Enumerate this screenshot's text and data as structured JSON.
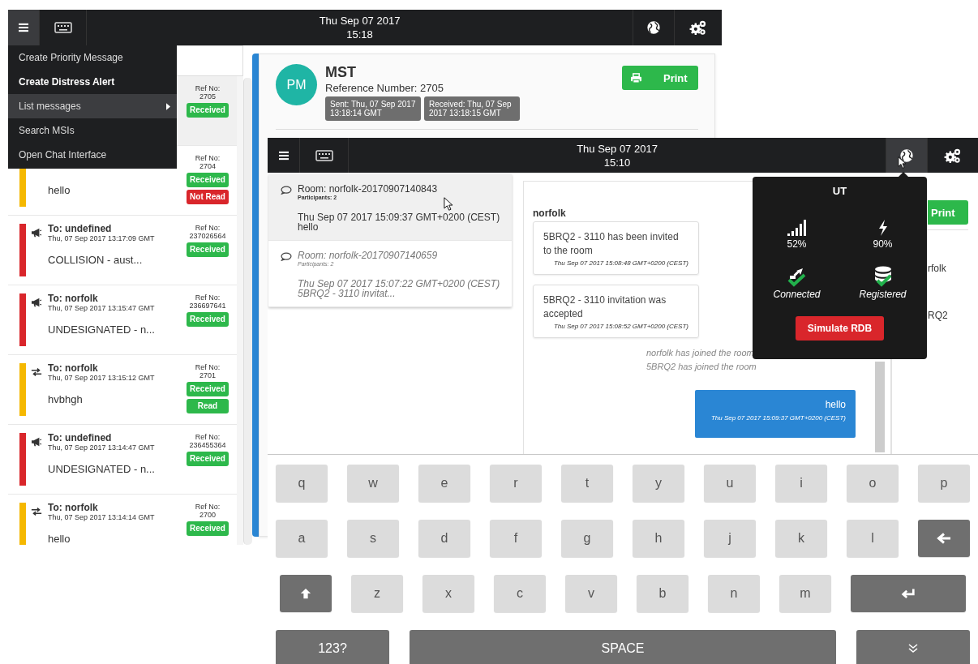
{
  "back_window": {
    "header": {
      "menu_selected": true,
      "date": "Thu Sep 07 2017",
      "time": "15:18"
    },
    "menu": [
      {
        "label": "Create Priority Message",
        "bold": false,
        "selected": false,
        "submenu": false
      },
      {
        "label": "Create Distress Alert",
        "bold": true,
        "selected": false,
        "submenu": false
      },
      {
        "label": "List messages",
        "bold": false,
        "selected": true,
        "submenu": true
      },
      {
        "label": "Search MSIs",
        "bold": false,
        "selected": false,
        "submenu": false
      },
      {
        "label": "Open Chat Interface",
        "bold": false,
        "selected": false,
        "submenu": false
      }
    ],
    "messages": [
      {
        "selected": true,
        "ref_label": "Ref No:",
        "ref": "2705",
        "badges": [
          {
            "label": "Received",
            "kind": "ok"
          }
        ]
      },
      {
        "selected": false,
        "color": "#f5b800",
        "body": "hello",
        "ref_label": "Ref No:",
        "ref": "2704",
        "badges": [
          {
            "label": "Received",
            "kind": "ok"
          },
          {
            "label": "Not Read",
            "kind": "alert"
          }
        ]
      },
      {
        "selected": false,
        "color": "#d9262b",
        "kind": "broadcast",
        "to": "To: undefined",
        "date": "Thu, 07 Sep 2017 13:17:09 GMT",
        "body": "COLLISION - aust...",
        "ref_label": "Ref No:",
        "ref": "237026564",
        "badges": [
          {
            "label": "Received",
            "kind": "ok"
          }
        ]
      },
      {
        "selected": false,
        "color": "#d9262b",
        "kind": "broadcast",
        "to": "To: norfolk",
        "date": "Thu, 07 Sep 2017 13:15:47 GMT",
        "body": "UNDESIGNATED - n...",
        "ref_label": "Ref No:",
        "ref": "236697641",
        "badges": [
          {
            "label": "Received",
            "kind": "ok"
          }
        ]
      },
      {
        "selected": false,
        "color": "#f5b800",
        "kind": "exchange",
        "to": "To: norfolk",
        "date": "Thu, 07 Sep 2017 13:15:12 GMT",
        "body": "hvbhgh",
        "ref_label": "Ref No:",
        "ref": "2701",
        "badges": [
          {
            "label": "Received",
            "kind": "ok"
          },
          {
            "label": "Read",
            "kind": "ok"
          }
        ]
      },
      {
        "selected": false,
        "color": "#d9262b",
        "kind": "broadcast",
        "to": "To: undefined",
        "date": "Thu, 07 Sep 2017 13:14:47 GMT",
        "body": "UNDESIGNATED - n...",
        "ref_label": "Ref No:",
        "ref": "236455364",
        "badges": [
          {
            "label": "Received",
            "kind": "ok"
          }
        ]
      },
      {
        "selected": false,
        "color": "#f5b800",
        "kind": "exchange",
        "to": "To: norfolk",
        "date": "Thu, 07 Sep 2017 13:14:14 GMT",
        "body": "hello",
        "ref_label": "Ref No:",
        "ref": "2700",
        "badges": [
          {
            "label": "Received",
            "kind": "ok"
          }
        ]
      }
    ],
    "detail": {
      "avatar": "PM",
      "title": "MST",
      "reference": "Reference Number: 2705",
      "chips": [
        "Sent: Thu, 07 Sep 2017 13:18:14 GMT",
        "Received: Thu, 07 Sep 2017 13:18:15 GMT"
      ],
      "print": "Print"
    }
  },
  "front_window": {
    "header": {
      "globe_selected": true,
      "date": "Thu Sep 07 2017",
      "time": "15:10"
    },
    "rooms": [
      {
        "selected": true,
        "name": "Room: norfolk-20170907140843",
        "participants": "Participants: 2",
        "date": "Thu Sep 07 2017 15:09:37 GMT+0200 (CEST)",
        "preview": "hello"
      },
      {
        "selected": false,
        "name": "Room: norfolk-20170907140659",
        "participants": "Participants: 2",
        "date": "Thu Sep 07 2017 15:07:22 GMT+0200 (CEST)",
        "preview": "5BRQ2 - 3110 invitat..."
      }
    ],
    "chat": {
      "title": "norfolk",
      "cards": [
        {
          "text": "5BRQ2 - 3110 has been invited to the room",
          "time": "Thu Sep 07 2017 15:08:48 GMT+0200 (CEST)"
        },
        {
          "text": "5BRQ2 - 3110 invitation was accepted",
          "time": "Thu Sep 07 2017 15:08:52 GMT+0200 (CEST)"
        }
      ],
      "events": [
        "norfolk has joined the room",
        "5BRQ2 has joined the room"
      ],
      "own": {
        "text": "hello",
        "time": "Thu Sep 07 2017 15:09:37 GMT+0200 (CEST)"
      }
    },
    "side": {
      "print": "Print",
      "lines": [
        "rfolk",
        "RQ2"
      ]
    },
    "status_popup": {
      "title": "UT",
      "items": [
        {
          "kind": "signal",
          "label": "52%"
        },
        {
          "kind": "power",
          "label": "90%"
        },
        {
          "kind": "connected",
          "label": "Connected"
        },
        {
          "kind": "registered",
          "label": "Registered"
        }
      ],
      "action": "Simulate RDB"
    },
    "keyboard": {
      "rows": [
        [
          {
            "kind": "letter",
            "label": "q"
          },
          {
            "kind": "letter",
            "label": "w"
          },
          {
            "kind": "letter",
            "label": "e"
          },
          {
            "kind": "letter",
            "label": "r"
          },
          {
            "kind": "letter",
            "label": "t"
          },
          {
            "kind": "letter",
            "label": "y"
          },
          {
            "kind": "letter",
            "label": "u"
          },
          {
            "kind": "letter",
            "label": "i"
          },
          {
            "kind": "letter",
            "label": "o"
          },
          {
            "kind": "letter",
            "label": "p"
          }
        ],
        [
          {
            "kind": "letter",
            "label": "a"
          },
          {
            "kind": "letter",
            "label": "s"
          },
          {
            "kind": "letter",
            "label": "d"
          },
          {
            "kind": "letter",
            "label": "f"
          },
          {
            "kind": "letter",
            "label": "g"
          },
          {
            "kind": "letter",
            "label": "h"
          },
          {
            "kind": "letter",
            "label": "j"
          },
          {
            "kind": "letter",
            "label": "k"
          },
          {
            "kind": "letter",
            "label": "l"
          },
          {
            "kind": "backspace"
          }
        ],
        [
          {
            "kind": "shift"
          },
          {
            "kind": "letter",
            "label": "z"
          },
          {
            "kind": "letter",
            "label": "x"
          },
          {
            "kind": "letter",
            "label": "c"
          },
          {
            "kind": "letter",
            "label": "v"
          },
          {
            "kind": "letter",
            "label": "b"
          },
          {
            "kind": "letter",
            "label": "n"
          },
          {
            "kind": "letter",
            "label": "m"
          },
          {
            "kind": "enter"
          }
        ],
        [
          {
            "kind": "mode",
            "label": "123?"
          },
          {
            "kind": "space",
            "label": "SPACE"
          },
          {
            "kind": "hide"
          }
        ]
      ]
    }
  }
}
